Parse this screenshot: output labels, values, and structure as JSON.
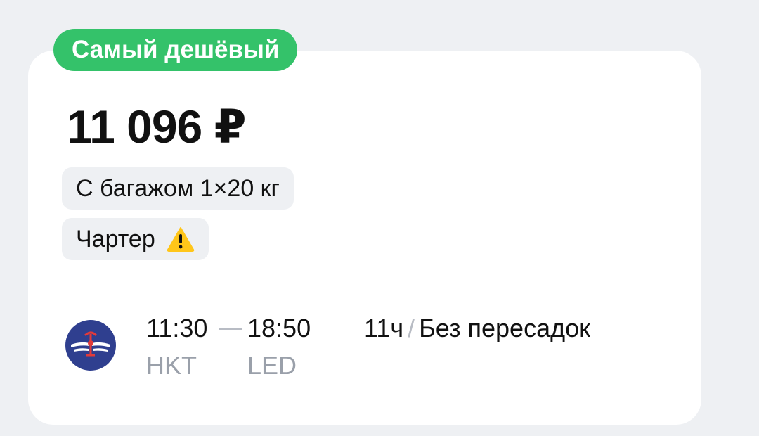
{
  "badge": {
    "label": "Самый дешёвый",
    "color": "#34c26a"
  },
  "price": {
    "text": "11 096 ₽"
  },
  "tags": [
    {
      "label": "С багажом 1×20 кг"
    },
    {
      "label": "Чартер",
      "icon": "warning-icon"
    }
  ],
  "flight": {
    "airline_logo": "aeroflot-logo",
    "departure": {
      "time": "11:30",
      "code": "HKT"
    },
    "arrival": {
      "time": "18:50",
      "code": "LED"
    },
    "duration": "11ч",
    "separator": "/",
    "stops": "Без пересадок"
  },
  "colors": {
    "background": "#eef0f3",
    "card": "#ffffff",
    "muted": "#9aa0aa",
    "warning": "#ffc61a"
  }
}
